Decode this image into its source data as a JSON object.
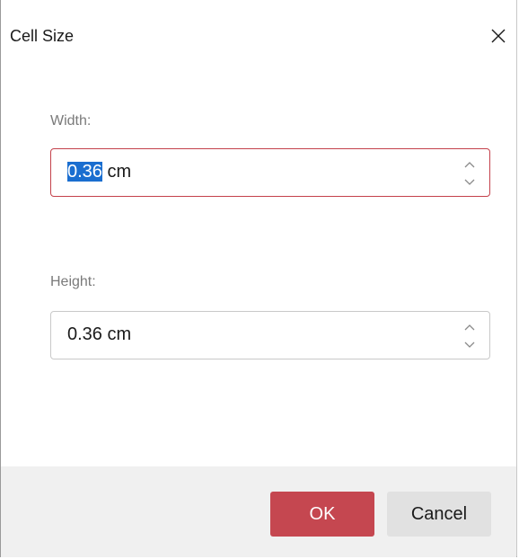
{
  "dialog": {
    "title": "Cell Size",
    "close_icon": "close-icon"
  },
  "width_field": {
    "label": "Width:",
    "value_selected": "0.36",
    "value_rest": " cm"
  },
  "height_field": {
    "label": "Height:",
    "value": "0.36 cm"
  },
  "buttons": {
    "ok_label": "OK",
    "cancel_label": "Cancel"
  },
  "colors": {
    "accent": "#c54750",
    "focus_border": "#c4414b",
    "selection": "#1a6ed0",
    "footer_bg": "#f0f0f0"
  }
}
